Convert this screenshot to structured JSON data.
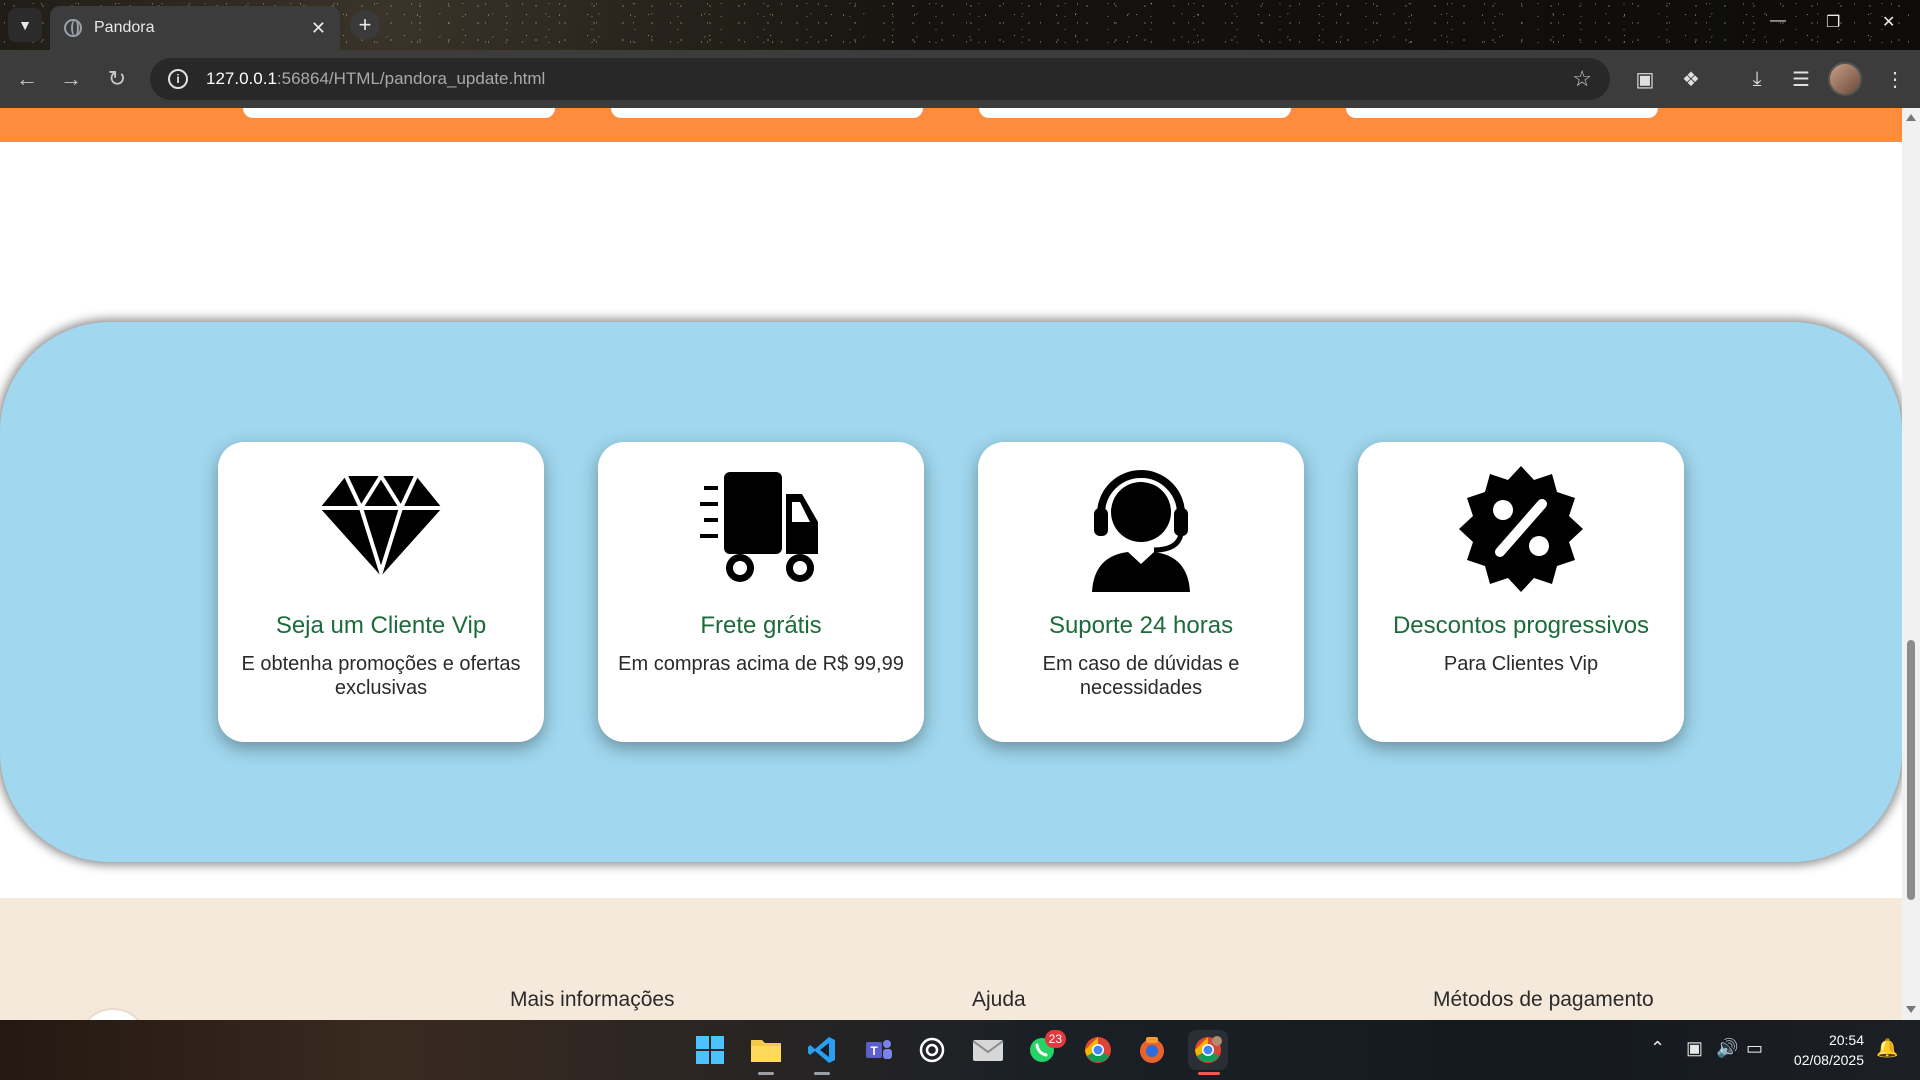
{
  "browser": {
    "tab_title": "Pandora",
    "url_host": "127.0.0.1",
    "url_path": ":56864/HTML/pandora_update.html",
    "tab_menu_icon": "chevron-down-icon",
    "new_tab_icon": "plus-icon"
  },
  "page": {
    "colors": {
      "orange_band": "#fd8d3c",
      "blue_section": "#a1d8ef",
      "card_title": "#1d6b3a",
      "footer_bg": "#f5e9db"
    },
    "benefits": [
      {
        "icon": "diamond-icon",
        "title": "Seja um Cliente Vip",
        "desc": "E obtenha promoções e ofertas exclusivas"
      },
      {
        "icon": "delivery-truck-icon",
        "title": "Frete grátis",
        "desc": "Em compras acima de R$ 99,99"
      },
      {
        "icon": "headset-support-icon",
        "title": "Suporte 24 horas",
        "desc": "Em caso de dúvidas e necessidades"
      },
      {
        "icon": "discount-badge-icon",
        "title": "Descontos progressivos",
        "desc": "Para Clientes Vip"
      }
    ],
    "footer": {
      "col1": "Mais informações",
      "col2": "Ajuda",
      "col3": "Métodos de pagamento"
    }
  },
  "taskbar": {
    "whatsapp_badge": "23",
    "time": "20:54",
    "date": "02/08/2025"
  }
}
